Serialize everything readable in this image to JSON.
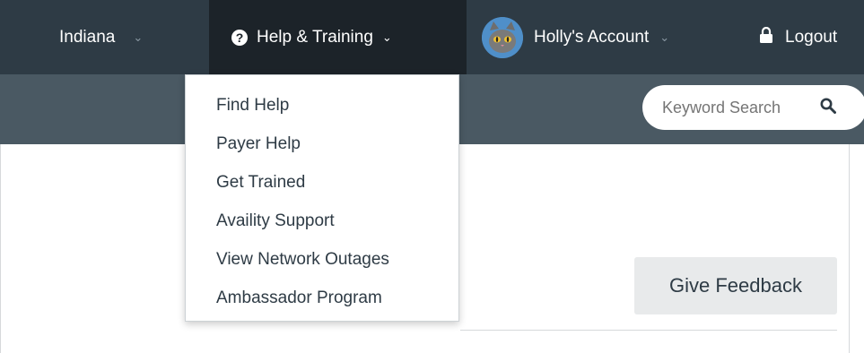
{
  "topnav": {
    "state": {
      "label": "Indiana",
      "chevron": "chevron-down-icon"
    },
    "help": {
      "label": "Help & Training",
      "icon": "question-circle-icon",
      "chevron": "chevron-down-icon"
    },
    "account": {
      "label": "Holly's Account",
      "avatar": "cat-avatar",
      "chevron": "chevron-down-icon"
    },
    "logout": {
      "label": "Logout",
      "icon": "lock-icon"
    }
  },
  "help_menu": {
    "items": [
      {
        "label": "Find Help"
      },
      {
        "label": "Payer Help"
      },
      {
        "label": "Get Trained"
      },
      {
        "label": "Availity Support"
      },
      {
        "label": "View Network Outages"
      },
      {
        "label": "Ambassador Program"
      }
    ]
  },
  "search": {
    "placeholder": "Keyword Search",
    "icon": "search-icon"
  },
  "main": {
    "feedback_label": "Give Feedback"
  },
  "colors": {
    "topbar": "#2e3b45",
    "topbar_active": "#1c2329",
    "subbar": "#4a5963",
    "text_dark": "#2e3b45",
    "button_bg": "#e8eaeb"
  }
}
